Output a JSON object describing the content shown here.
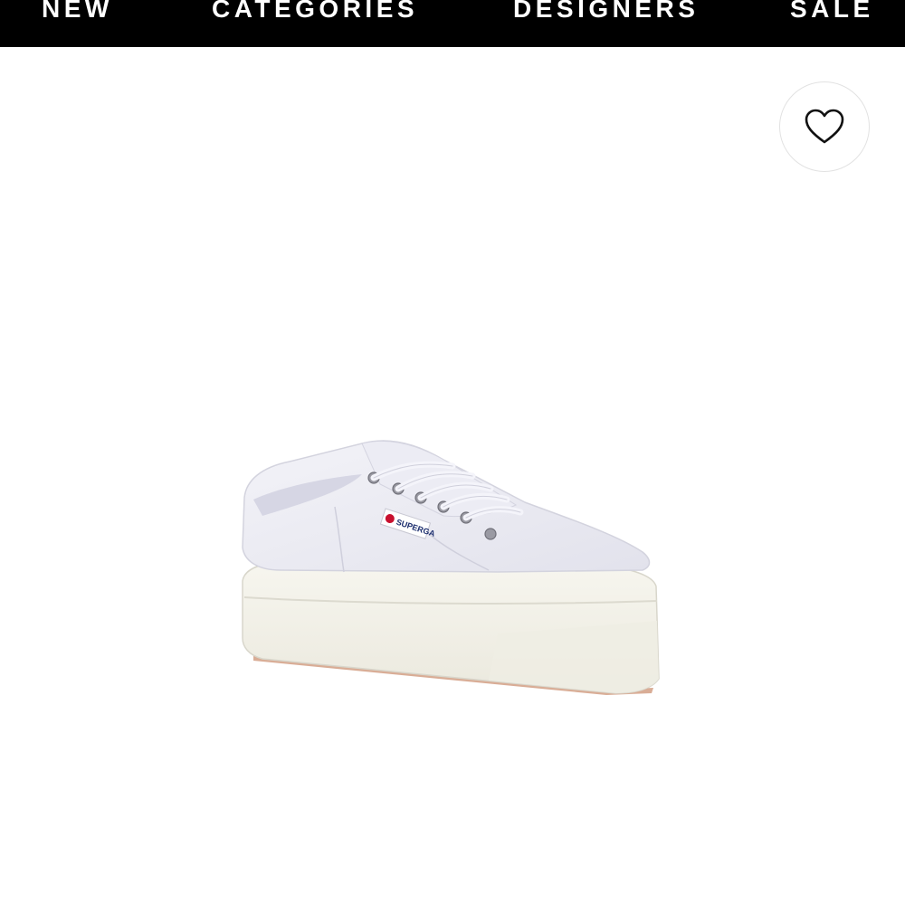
{
  "nav": {
    "items": [
      {
        "label": "NEW"
      },
      {
        "label": "CATEGORIES"
      },
      {
        "label": "DESIGNERS"
      },
      {
        "label": "SALE"
      }
    ]
  },
  "product": {
    "brand_tag": "SUPERGA",
    "wishlist_icon": "heart-outline-icon"
  },
  "colors": {
    "nav_background": "#000000",
    "nav_text": "#ffffff",
    "page_background": "#ffffff",
    "tag_red": "#c8102e",
    "tag_blue": "#1c2e6e"
  }
}
